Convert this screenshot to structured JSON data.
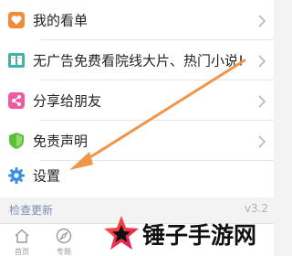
{
  "menu": {
    "items": [
      {
        "label": "我的看单",
        "icon": "heart-icon",
        "color": "#f28b38"
      },
      {
        "label": "无广告免费看院线大片、热门小说!",
        "icon": "book-icon",
        "color": "#3fb2a9"
      },
      {
        "label": "分享给朋友",
        "icon": "share-icon",
        "color": "#f05aa0"
      },
      {
        "label": "免责声明",
        "icon": "shield-icon",
        "color": "#5cbf3c"
      },
      {
        "label": "设置",
        "icon": "gear-icon",
        "color": "#3b8fe0"
      }
    ]
  },
  "update": {
    "label": "检查更新",
    "version": "v3.2"
  },
  "tabbar": {
    "tabs": [
      {
        "label": "首页",
        "icon": "home-icon"
      },
      {
        "label": "专题",
        "icon": "compass-icon"
      }
    ]
  },
  "watermark": {
    "text": "锤子手游网",
    "logo": "star-logo-icon"
  },
  "annotation": {
    "arrow_color": "#f0954a"
  }
}
